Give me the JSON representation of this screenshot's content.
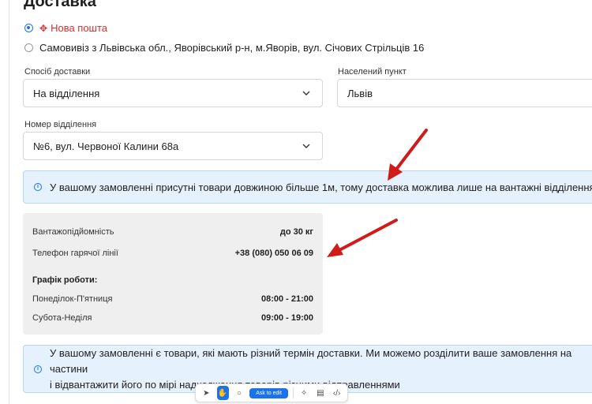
{
  "page": {
    "title": "Доставка"
  },
  "delivery_options": [
    {
      "label": "Нова пошта",
      "checked": true,
      "icon": "nova-poshta-logo-icon",
      "color": "#e52b2b"
    },
    {
      "label": "Самовивіз з Львівська обл., Яворівський р-н, м.Яворів, вул. Січових Стрільців 16",
      "checked": false
    }
  ],
  "form": {
    "method_label": "Спосіб доставки",
    "method_value": "На відділення",
    "city_label": "Населений пункт",
    "city_value": "Львів",
    "branch_label": "Номер відділення",
    "branch_value": "№6, вул. Червоної Калини 68а"
  },
  "banners": {
    "cargo_notice": "У вашому замовленні присутні товари довжиною більше 1м, тому доставка можлива лише на вантажні відділення",
    "split_notice_line1": "У вашому замовленні є товари, які мають різний термін доставки. Ми можемо розділити ваше замовлення на частини",
    "split_notice_line2": "і відвантажити його по мірі надходження товарів різними відправленнями"
  },
  "branch_details": {
    "capacity_label": "Вантажопідйомність",
    "capacity_value": "до 30 кг",
    "hotline_label": "Телефон гарячої лінії",
    "hotline_value": "+38 (080) 050 06 09",
    "schedule_title": "Графік роботи:",
    "weekday_label": "Понеділок-П'ятниця",
    "weekday_hours": "08:00 - 21:00",
    "weekend_label": "Субота-Неділя",
    "weekend_hours": "09:00 - 19:00"
  },
  "toolbar": {
    "ask_label": "Ask to edit"
  },
  "colors": {
    "accent": "#1a73e8",
    "brand_red": "#e52b2b",
    "annotation_arrow": "#d11a1a",
    "info_bg": "#e5f1fd"
  }
}
